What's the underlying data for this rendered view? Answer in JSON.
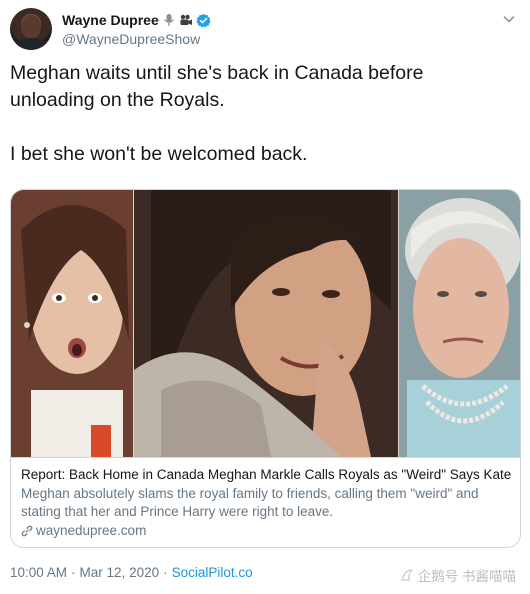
{
  "author": {
    "name": "Wayne Dupree",
    "handle": "@WayneDupreeShow",
    "badges": [
      "microphone-icon",
      "video-camera-icon",
      "verified-icon"
    ]
  },
  "tweet": {
    "line1": "Meghan waits until she's back in Canada before unloading on the Royals.",
    "line2": "I bet she won't be welcomed back."
  },
  "card": {
    "title": "Report: Back Home in Canada Meghan Markle Calls Royals as \"Weird\" Says Kate ...",
    "description": "Meghan absolutely slams the royal family to friends, calling them \"weird\" and stating that her and Prince Harry were right to leave.",
    "domain": "waynedupree.com"
  },
  "meta": {
    "time": "10:00 AM",
    "separator1": "·",
    "date": "Mar 12, 2020",
    "separator2": "·",
    "source": "SocialPilot.co"
  },
  "watermark": {
    "text": "企鹅号 书酱喵喵"
  },
  "colors": {
    "text": "#14171a",
    "secondary": "#657786",
    "link": "#1b95e0",
    "border": "#ccd6dd",
    "verified": "#1da1f2"
  }
}
